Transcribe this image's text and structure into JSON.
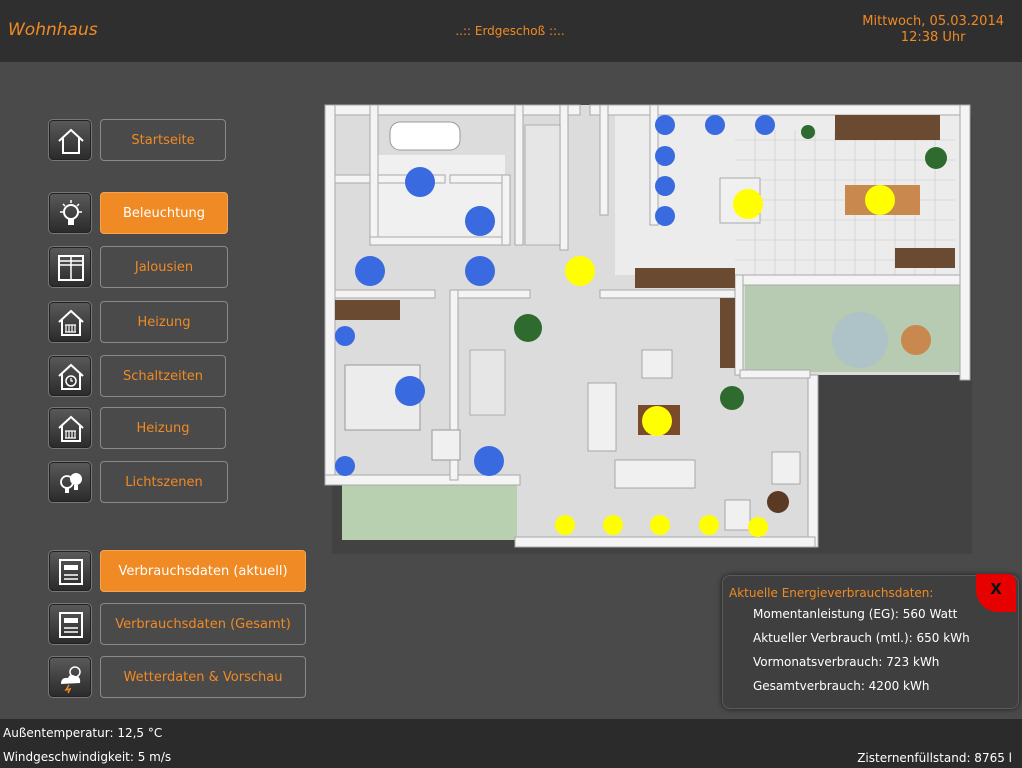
{
  "header": {
    "app_title": "Wohnhaus",
    "floor_title": "..:: Erdgeschoß ::..",
    "date": "Mittwoch, 05.03.2014",
    "time": "12:38 Uhr"
  },
  "nav": {
    "items": [
      {
        "label": "Startseite",
        "icon": "home-icon",
        "active": false
      },
      {
        "label": "Beleuchtung",
        "icon": "light-bulb-icon",
        "active": true
      },
      {
        "label": "Jalousien",
        "icon": "window-blinds-icon",
        "active": false
      },
      {
        "label": "Heizung",
        "icon": "house-heating-icon",
        "active": false
      },
      {
        "label": "Schaltzeiten",
        "icon": "house-clock-icon",
        "active": false
      },
      {
        "label": "Heizung",
        "icon": "house-heating-icon",
        "active": false
      },
      {
        "label": "Lichtszenen",
        "icon": "light-bulbs-icon",
        "active": false
      },
      {
        "label": "Verbrauchsdaten (aktuell)",
        "icon": "meter-icon",
        "active": true
      },
      {
        "label": "Verbrauchsdaten (Gesamt)",
        "icon": "meter-icon",
        "active": false
      },
      {
        "label": "Wetterdaten & Vorschau",
        "icon": "weather-icon",
        "active": false
      }
    ]
  },
  "energy": {
    "title": "Aktuelle Energieverbrauchsdaten:",
    "lines": [
      "Momentanleistung (EG): 560 Watt",
      "Aktueller Verbrauch (mtl.): 650 kWh",
      "Vormonatsverbrauch: 723 kWh",
      "Gesamtverbrauch: 4200 kWh"
    ],
    "close_label": "X"
  },
  "footer": {
    "outside_temp": "Außentemperatur: 12,5 °C",
    "wind_speed": "Windgeschwindigkeit: 5 m/s",
    "cistern": "Zisternenfüllstand: 8765 l"
  },
  "colors": {
    "accent": "#f08a24",
    "light_on": "#ffff00",
    "light_off": "#3a6ae0",
    "close": "#e60000"
  }
}
